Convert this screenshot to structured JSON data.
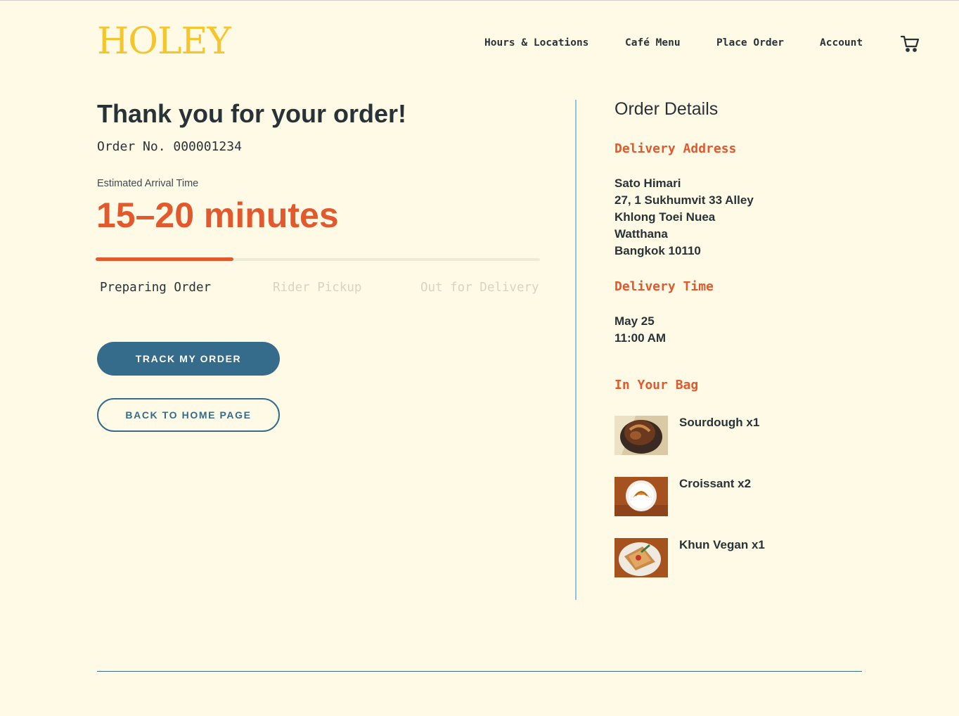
{
  "header": {
    "logo": "HOLEY",
    "nav": [
      "Hours & Locations",
      "Café Menu",
      "Place Order",
      "Account"
    ],
    "cart_icon": "cart-icon"
  },
  "confirmation": {
    "title": "Thank you for your order!",
    "order_number": "Order No. 000001234",
    "eta_label": "Estimated Arrival Time",
    "eta_value": "15–20 minutes",
    "progress_fraction": 0.31,
    "steps": [
      {
        "label": "Preparing Order",
        "active": true
      },
      {
        "label": "Rider Pickup",
        "active": false
      },
      {
        "label": "Out for Delivery",
        "active": false
      }
    ],
    "track_button": "TRACK MY ORDER",
    "home_button": "BACK TO HOME PAGE"
  },
  "details": {
    "title": "Order Details",
    "address_title": "Delivery Address",
    "address_lines": [
      "Sato Himari",
      "27, 1 Sukhumvit 33 Alley",
      "Khlong Toei Nuea",
      "Watthana",
      "Bangkok 10110"
    ],
    "time_title": "Delivery Time",
    "time_lines": [
      "May 25",
      "11:00 AM"
    ],
    "bag_title": "In Your Bag",
    "bag_items": [
      {
        "label": "Sourdough x1",
        "thumb": "sourdough-image"
      },
      {
        "label": "Croissant x2",
        "thumb": "croissant-image"
      },
      {
        "label": "Khun Vegan x1",
        "thumb": "sandwich-image"
      }
    ]
  },
  "colors": {
    "background": "#fffae6",
    "accent": "#e2592e",
    "primary": "#356b8b",
    "logo": "#f4c52c",
    "text": "#283338"
  }
}
